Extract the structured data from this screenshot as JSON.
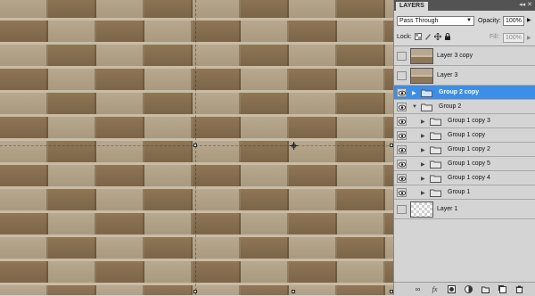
{
  "panel": {
    "tab_label": "LAYERS",
    "controls_label": "◂◂ ✕",
    "blend_mode": "Pass Through",
    "opacity_label": "Opacity:",
    "opacity_value": "100%",
    "lock_label": "Lock:",
    "fill_label": "Fill:",
    "fill_value": "100%"
  },
  "layers": [
    {
      "name": "Layer 3 copy",
      "kind": "pixel",
      "visible": false,
      "selected": false
    },
    {
      "name": "Layer 3",
      "kind": "pixel",
      "visible": false,
      "selected": false
    },
    {
      "name": "Group 2 copy",
      "kind": "group",
      "visible": true,
      "selected": true,
      "expanded": false,
      "indent": 0
    },
    {
      "name": "Group 2",
      "kind": "group",
      "visible": true,
      "selected": false,
      "expanded": true,
      "indent": 0
    },
    {
      "name": "Group 1 copy 3",
      "kind": "group",
      "visible": true,
      "selected": false,
      "expanded": false,
      "indent": 1
    },
    {
      "name": "Group 1 copy",
      "kind": "group",
      "visible": true,
      "selected": false,
      "expanded": false,
      "indent": 1
    },
    {
      "name": "Group 1 copy 2",
      "kind": "group",
      "visible": true,
      "selected": false,
      "expanded": false,
      "indent": 1
    },
    {
      "name": "Group 1 copy 5",
      "kind": "group",
      "visible": true,
      "selected": false,
      "expanded": false,
      "indent": 1
    },
    {
      "name": "Group 1 copy 4",
      "kind": "group",
      "visible": true,
      "selected": false,
      "expanded": false,
      "indent": 1
    },
    {
      "name": "Group 1",
      "kind": "group",
      "visible": true,
      "selected": false,
      "expanded": false,
      "indent": 1
    },
    {
      "name": "Layer 1",
      "kind": "transparent",
      "visible": false,
      "selected": false
    }
  ],
  "bottom_icons": [
    "link-icon",
    "fx-icon",
    "mask-icon",
    "adjustment-icon",
    "new-group-icon",
    "new-layer-icon",
    "trash-icon"
  ],
  "colors": {
    "selection": "#3d8ee6",
    "panel_bg": "#d4d4d4",
    "tabbar": "#535353",
    "brick_light": "#b7a88f",
    "brick_dark": "#8e7656",
    "mortar": "#c9bca6"
  }
}
